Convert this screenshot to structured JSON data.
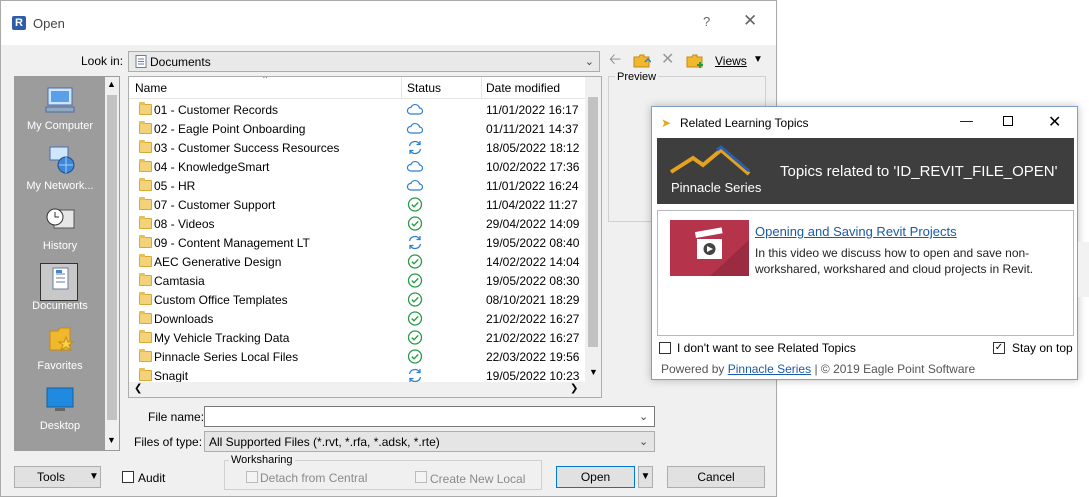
{
  "dialog": {
    "title": "Open",
    "help": "?",
    "close": "✕",
    "look_in_label": "Look in:",
    "look_in_value": "Documents",
    "views_label": "Views",
    "preview_label": "Preview"
  },
  "places": [
    {
      "label": "My Computer",
      "icon": "computer-icon"
    },
    {
      "label": "My Network...",
      "icon": "network-icon"
    },
    {
      "label": "History",
      "icon": "history-icon"
    },
    {
      "label": "Documents",
      "icon": "documents-icon",
      "active": true
    },
    {
      "label": "Favorites",
      "icon": "favorites-icon"
    },
    {
      "label": "Desktop",
      "icon": "desktop-icon"
    }
  ],
  "columns": {
    "name": "Name",
    "status": "Status",
    "date": "Date modified"
  },
  "files": [
    {
      "name": "01 - Customer Records",
      "status": "cloud",
      "date": "11/01/2022 16:17"
    },
    {
      "name": "02 - Eagle Point Onboarding",
      "status": "cloud",
      "date": "01/11/2021 14:37"
    },
    {
      "name": "03 - Customer Success Resources",
      "status": "sync",
      "date": "18/05/2022 18:12"
    },
    {
      "name": "04 - KnowledgeSmart",
      "status": "cloud",
      "date": "10/02/2022 17:36"
    },
    {
      "name": "05 - HR",
      "status": "cloud",
      "date": "11/01/2022 16:24"
    },
    {
      "name": "07 - Customer Support",
      "status": "ok",
      "date": "11/04/2022 11:27"
    },
    {
      "name": "08 - Videos",
      "status": "ok",
      "date": "29/04/2022 14:09"
    },
    {
      "name": "09 - Content Management LT",
      "status": "sync",
      "date": "19/05/2022 08:40"
    },
    {
      "name": "AEC Generative Design",
      "status": "ok",
      "date": "14/02/2022 14:04"
    },
    {
      "name": "Camtasia",
      "status": "ok",
      "date": "19/05/2022 08:30"
    },
    {
      "name": "Custom Office Templates",
      "status": "ok",
      "date": "08/10/2021 18:29"
    },
    {
      "name": "Downloads",
      "status": "ok",
      "date": "21/02/2022 16:27"
    },
    {
      "name": "My Vehicle Tracking Data",
      "status": "ok",
      "date": "21/02/2022 16:27"
    },
    {
      "name": "Pinnacle Series Local Files",
      "status": "ok",
      "date": "22/03/2022 19:56"
    },
    {
      "name": "Snagit",
      "status": "sync",
      "date": "19/05/2022 10:23"
    }
  ],
  "form": {
    "file_name_label": "File name:",
    "file_name_value": "",
    "file_type_label": "Files of type:",
    "file_type_value": "All Supported Files  (*.rvt, *.rfa, *.adsk, *.rte)",
    "tools_label": "Tools",
    "audit_label": "Audit",
    "worksharing_label": "Worksharing",
    "detach_label": "Detach from Central",
    "create_local_label": "Create New Local",
    "open_label": "Open",
    "cancel_label": "Cancel"
  },
  "related": {
    "title": "Related Learning Topics",
    "logo_text": "Pinnacle Series",
    "heading": "Topics related to 'ID_REVIT_FILE_OPEN'",
    "link_title": "Opening and Saving Revit Projects",
    "description": "In this video we discuss how to open and save non-workshared, workshared and cloud projects in Revit.",
    "dont_show_label": "I don't want to see Related Topics",
    "stay_on_top_label": "Stay on top",
    "stay_on_top_checked": true,
    "footer_prefix": "Powered by",
    "footer_link": "Pinnacle Series",
    "footer_suffix": "| © 2019 Eagle Point Software"
  },
  "colors": {
    "cloud": "#2f7fd1",
    "sync": "#2f7fd1",
    "ok": "#2a9a48",
    "banner": "#3e3e3e",
    "video_thumb": "#b5334b"
  }
}
